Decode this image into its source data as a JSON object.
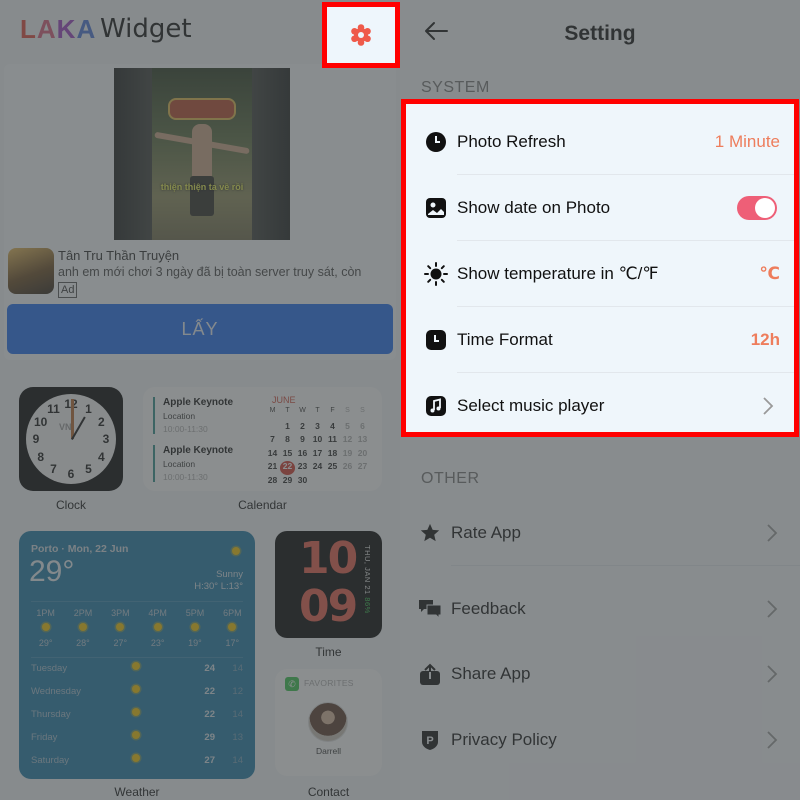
{
  "left": {
    "logo": {
      "letters": [
        "L",
        "A",
        "K",
        "A"
      ],
      "colors": [
        "#e0473a",
        "#d75a7a",
        "#9a3fbf",
        "#4a74d8"
      ]
    },
    "app_name": "Widget",
    "settings_button_icon": "gear-icon",
    "settings_icon_color": "#ef5a4a",
    "highlight_color": "#ff0000",
    "ad": {
      "video_caption": "thiện thiện ta về rồi",
      "title": "Tân Tru Thần Truyện",
      "description": "anh em mới chơi 3 ngày đã bị toàn server truy sát, còn",
      "badge": "Ad",
      "cta": "LẤY",
      "cta_color": "#1f6cf0"
    },
    "widgets": {
      "clock": {
        "label": "Clock",
        "brand": "VN",
        "numbers": [
          "12",
          "1",
          "2",
          "3",
          "4",
          "5",
          "6",
          "7",
          "8",
          "9",
          "10",
          "11"
        ],
        "time": "1:00"
      },
      "calendar": {
        "label": "Calendar",
        "events": [
          {
            "title": "Apple Keynote",
            "location": "Location",
            "time": "10:00-11:30"
          },
          {
            "title": "Apple Keynote",
            "location": "Location",
            "time": "10:00-11:30"
          }
        ],
        "month": "JUNE",
        "weekdays": [
          "M",
          "T",
          "W",
          "T",
          "F",
          "S",
          "S"
        ],
        "leading_blanks": 1,
        "days_in_month": 30,
        "today": 22
      },
      "weather": {
        "label": "Weather",
        "city_date": "Porto · Mon, 22 Jun",
        "temperature": "29°",
        "condition": "Sunny",
        "high_low": "H:30° L:13°",
        "hourly": [
          {
            "time": "1PM",
            "temp": "29°"
          },
          {
            "time": "2PM",
            "temp": "28°"
          },
          {
            "time": "3PM",
            "temp": "27°"
          },
          {
            "time": "4PM",
            "temp": "23°"
          },
          {
            "time": "5PM",
            "temp": "19°"
          },
          {
            "time": "6PM",
            "temp": "17°"
          }
        ],
        "daily": [
          {
            "day": "Tuesday",
            "high": "24",
            "low": "14"
          },
          {
            "day": "Wednesday",
            "high": "22",
            "low": "12"
          },
          {
            "day": "Thursday",
            "high": "22",
            "low": "14"
          },
          {
            "day": "Friday",
            "high": "29",
            "low": "13"
          },
          {
            "day": "Saturday",
            "high": "27",
            "low": "14"
          }
        ]
      },
      "time": {
        "label": "Time",
        "hours": "10",
        "minutes": "09",
        "date": "THU, JAN 21",
        "battery": "86%"
      },
      "contact": {
        "label": "Contact",
        "header": "FAVORITES",
        "name": "Darrell"
      }
    }
  },
  "right": {
    "title": "Setting",
    "back_icon": "arrow-left-icon",
    "sections": {
      "system": {
        "label": "SYSTEM",
        "items": [
          {
            "icon": "clock-icon",
            "label": "Photo Refresh",
            "value": "1 Minute"
          },
          {
            "icon": "photo-icon",
            "label": "Show date on Photo",
            "toggle_on": true
          },
          {
            "icon": "sun-icon",
            "label": "Show temperature in ℃/℉",
            "value": "℃"
          },
          {
            "icon": "clock-square-icon",
            "label": "Time Format",
            "value": "12h"
          },
          {
            "icon": "music-note-icon",
            "label": "Select music player",
            "chevron": true
          }
        ]
      },
      "other": {
        "label": "OTHER",
        "items": [
          {
            "icon": "star-icon",
            "label": "Rate App"
          },
          {
            "icon": "feedback-icon",
            "label": "Feedback"
          },
          {
            "icon": "share-icon",
            "label": "Share App"
          },
          {
            "icon": "privacy-shield-icon",
            "label": "Privacy Policy"
          }
        ]
      }
    },
    "accent_color": "#ee7d5c",
    "toggle_color": "#ee5f77"
  }
}
